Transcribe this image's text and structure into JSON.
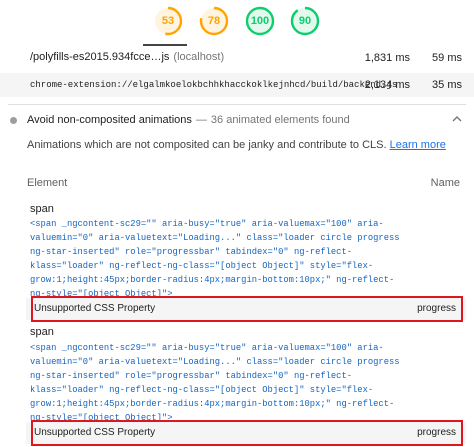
{
  "gauges": [
    {
      "value": "53",
      "color": "#ffa400",
      "fraction": 0.53
    },
    {
      "value": "78",
      "color": "#ffa400",
      "fraction": 0.78
    },
    {
      "value": "100",
      "color": "#0cce6b",
      "fraction": 1.0
    },
    {
      "value": "90",
      "color": "#0cce6b",
      "fraction": 0.9
    }
  ],
  "rows": [
    {
      "url": "/polyfills-es2015.934fcce…js",
      "host": "(localhost)",
      "ms1": "1,831 ms",
      "ms2": "59 ms"
    },
    {
      "url": "chrome-extension://elgalmkoelokbchhkhacckoklkejnhcd/build/backend.js",
      "host": "",
      "ms1": "2,134 ms",
      "ms2": "35 ms"
    }
  ],
  "audit": {
    "title": "Avoid non-composited animations",
    "separator": "—",
    "subtitle": "36 animated elements found",
    "description": "Animations which are not composited can be janky and contribute to CLS.",
    "learn_more": "Learn more"
  },
  "columns": {
    "element": "Element",
    "name": "Name"
  },
  "elements": [
    {
      "tag": "span",
      "snippet": "<span _ngcontent-sc29=\"\" aria-busy=\"true\" aria-valuemax=\"100\" aria-valuemin=\"0\" aria-valuetext=\"Loading...\" class=\"loader circle progress ng-star-inserted\" role=\"progressbar\" tabindex=\"0\" ng-reflect-klass=\"loader\" ng-reflect-ng-class=\"[object Object]\" style=\"flex-grow:1;height:45px;border-radius:4px;margin-bottom:10px;\" ng-reflect-ng-style=\"[object Object]\">",
      "reason": "Unsupported CSS Property",
      "property": "progress"
    },
    {
      "tag": "span",
      "snippet": "<span _ngcontent-sc29=\"\" aria-busy=\"true\" aria-valuemax=\"100\" aria-valuemin=\"0\" aria-valuetext=\"Loading...\" class=\"loader circle progress ng-star-inserted\" role=\"progressbar\" tabindex=\"0\" ng-reflect-klass=\"loader\" ng-reflect-ng-class=\"[object Object]\" style=\"flex-grow:1;height:45px;border-radius:4px;margin-bottom:10px;\" ng-reflect-ng-style=\"[object Object]\">",
      "reason": "Unsupported CSS Property",
      "property": "progress"
    }
  ],
  "icons": {
    "audit_marker": "gray-circle-icon",
    "expand": "chevron-up-icon"
  }
}
